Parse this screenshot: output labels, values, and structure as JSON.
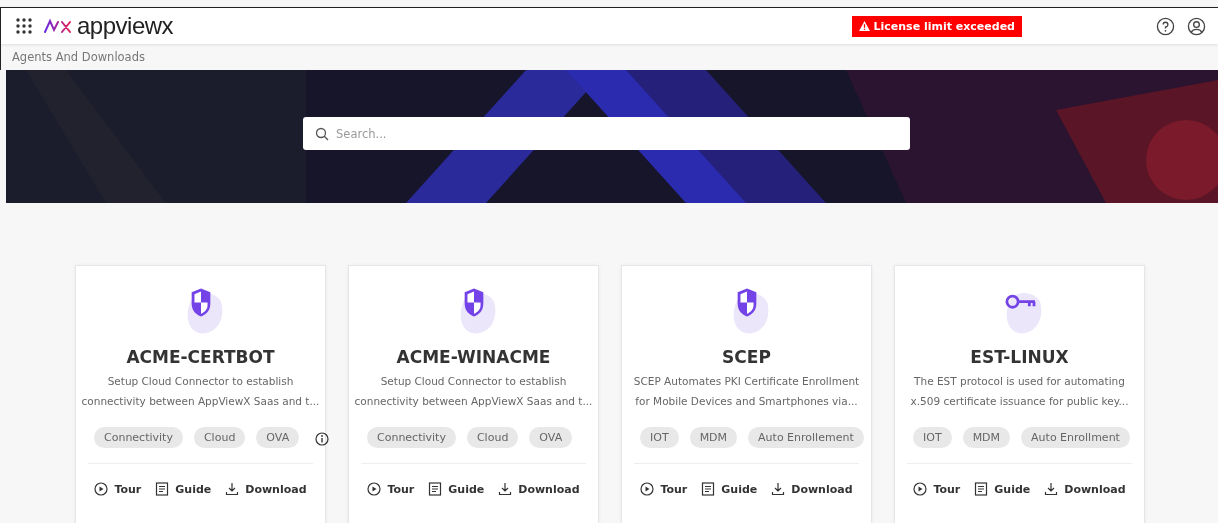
{
  "header": {
    "logo": "appviewx",
    "alert": "License limit exceeded"
  },
  "breadcrumb": "Agents And Downloads",
  "search": {
    "placeholder": "Search..."
  },
  "cards": [
    {
      "kind": "shield",
      "title": "ACME-CERTBOT",
      "description": [
        "Setup Cloud Connector to establish",
        "connectivity between AppViewX Saas and t..."
      ],
      "tags": [
        "Connectivity",
        "Cloud",
        "OVA"
      ],
      "info": true,
      "actions": [
        "Tour",
        "Guide",
        "Download"
      ]
    },
    {
      "kind": "shield",
      "title": "ACME-WINACME",
      "description": [
        "Setup Cloud Connector to establish",
        "connectivity between AppViewX Saas and t..."
      ],
      "tags": [
        "Connectivity",
        "Cloud",
        "OVA"
      ],
      "info": false,
      "actions": [
        "Tour",
        "Guide",
        "Download"
      ]
    },
    {
      "kind": "shield",
      "title": "SCEP",
      "description": [
        "SCEP Automates PKI Certificate Enrollment",
        "for Mobile Devices and Smartphones via..."
      ],
      "tags": [
        "IOT",
        "MDM",
        "Auto Enrollement"
      ],
      "info": false,
      "actions": [
        "Tour",
        "Guide",
        "Download"
      ]
    },
    {
      "kind": "key",
      "title": "EST-LINUX",
      "description": [
        "The EST protocol is used for automating",
        "x.509 certificate issuance for public key..."
      ],
      "tags": [
        "IOT",
        "MDM",
        "Auto Enrollment"
      ],
      "info": false,
      "actions": [
        "Tour",
        "Guide",
        "Download"
      ]
    }
  ]
}
